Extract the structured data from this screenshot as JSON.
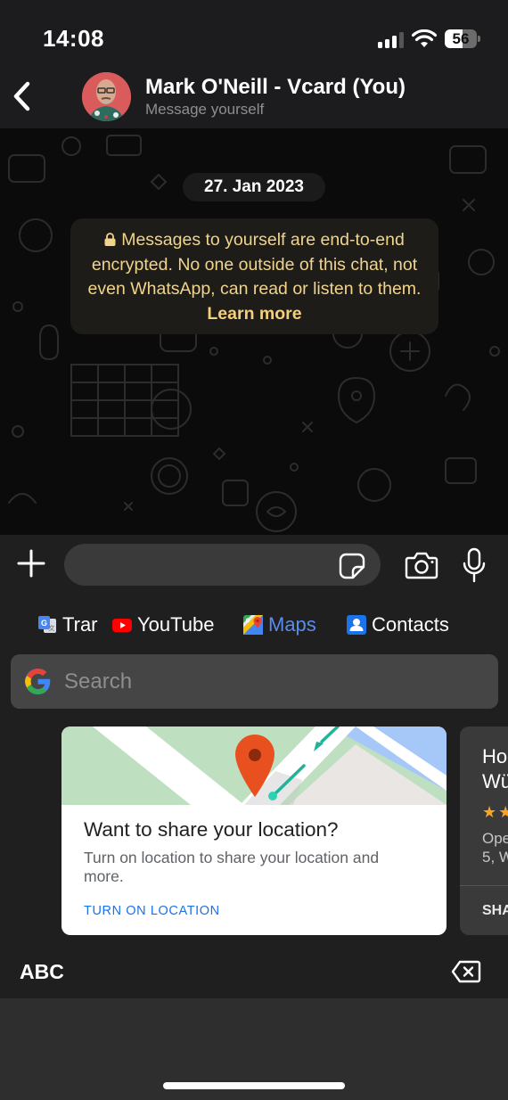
{
  "status_bar": {
    "time": "14:08",
    "battery_level": "56",
    "battery_fraction": 0.56,
    "signal_bars_active": 3,
    "signal_bars_total": 4
  },
  "header": {
    "back_label": "Back",
    "contact_name": "Mark O'Neill - Vcard (You)",
    "subtitle": "Message yourself"
  },
  "chat": {
    "date": "27. Jan 2023",
    "encryption_notice": {
      "text": "Messages to yourself are end-to-end encrypted. No one outside of this chat, not even WhatsApp, can read or listen to them.",
      "link": "Learn more"
    }
  },
  "composer": {
    "input_value": "",
    "input_placeholder": ""
  },
  "keyboard": {
    "apps": [
      {
        "label": "Trar",
        "icon": "google-translate-icon",
        "active": false
      },
      {
        "label": "YouTube",
        "icon": "youtube-icon",
        "active": false
      },
      {
        "label": "Maps",
        "icon": "google-maps-icon",
        "active": true
      },
      {
        "label": "Contacts",
        "icon": "contacts-icon",
        "active": false
      }
    ],
    "search": {
      "placeholder": "Search",
      "value": ""
    },
    "cards": [
      {
        "title": "Want to share your location?",
        "description": "Turn on location to share your location and more.",
        "action": "TURN ON LOCATION"
      },
      {
        "title_lines": [
          "Ho",
          "Wü"
        ],
        "stars": "★★",
        "address_lines": [
          "Ope",
          "5, W"
        ],
        "action": "SHA"
      }
    ],
    "abc_label": "ABC"
  },
  "colors": {
    "accent_blue": "#1a73e8",
    "maps_active": "#5a8cf0",
    "notice_text": "#f1d48c",
    "star": "#f5a623"
  }
}
